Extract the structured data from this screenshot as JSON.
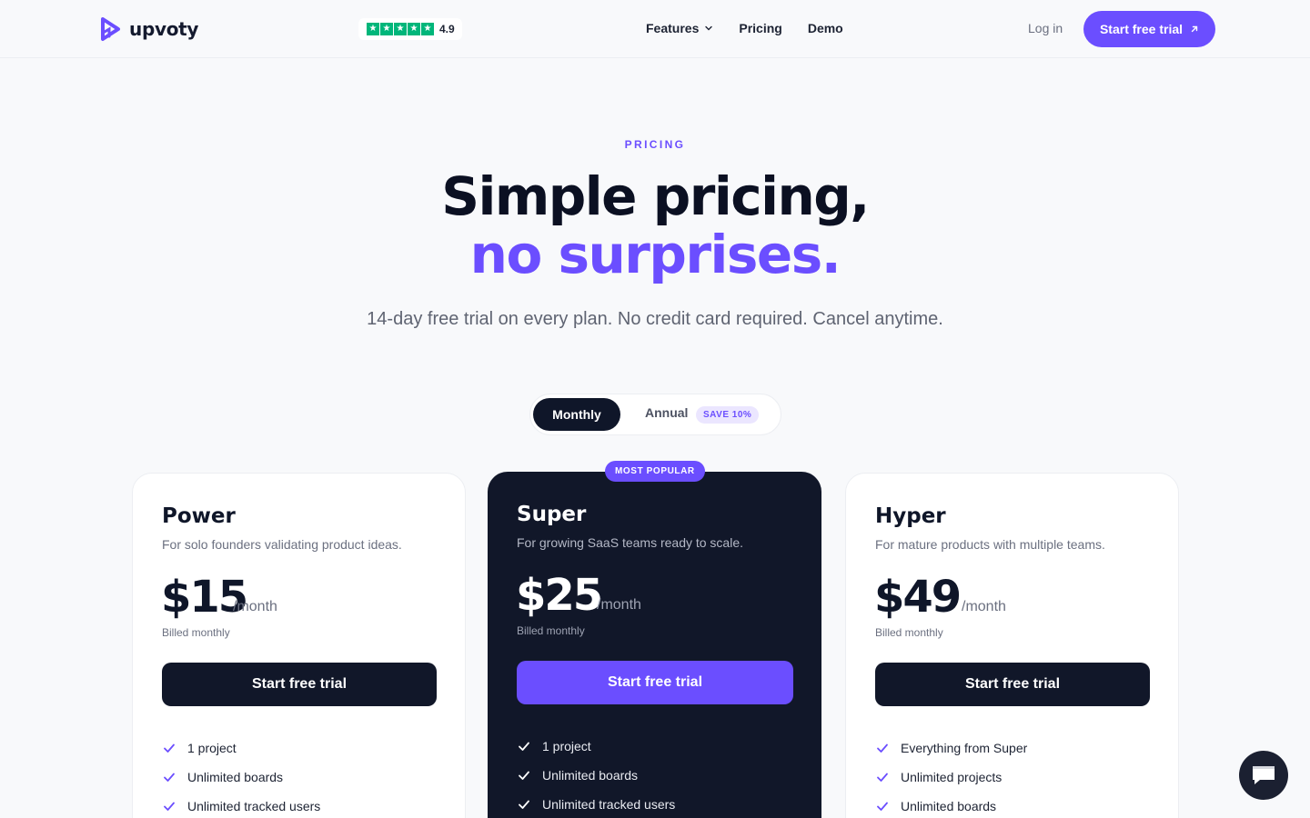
{
  "nav": {
    "brand": "upvoty",
    "rating": "4.9",
    "menu": [
      {
        "label": "Features"
      },
      {
        "label": "Pricing"
      },
      {
        "label": "Demo"
      }
    ],
    "login": "Log in",
    "cta": "Start free trial"
  },
  "hero": {
    "eyebrow": "PRICING",
    "title_line1": "Simple pricing,",
    "title_line2": "no surprises.",
    "subtitle": "14-day free trial on every plan. No credit card required. Cancel anytime."
  },
  "billing_toggle": {
    "monthly": "Monthly",
    "annual": "Annual",
    "save_badge": "SAVE 10%",
    "selected": "Monthly"
  },
  "popular_badge": "MOST POPULAR",
  "plans": [
    {
      "name": "Power",
      "description": "For solo founders validating product ideas.",
      "price": "$15",
      "period": "/month",
      "billing": "Billed monthly",
      "cta": "Start free trial",
      "features": [
        "1 project",
        "Unlimited boards",
        "Unlimited tracked users"
      ]
    },
    {
      "name": "Super",
      "description": "For growing SaaS teams ready to scale.",
      "price": "$25",
      "period": "/month",
      "billing": "Billed monthly",
      "cta": "Start free trial",
      "features": [
        "1 project",
        "Unlimited boards",
        "Unlimited tracked users"
      ]
    },
    {
      "name": "Hyper",
      "description": "For mature products with multiple teams.",
      "price": "$49",
      "period": "/month",
      "billing": "Billed monthly",
      "cta": "Start free trial",
      "features": [
        "Everything from Super",
        "Unlimited projects",
        "Unlimited boards"
      ]
    }
  ],
  "colors": {
    "accent": "#6b4eff",
    "dark": "#111729",
    "background": "#f8f9fb",
    "trustpilot": "#00b67a"
  }
}
